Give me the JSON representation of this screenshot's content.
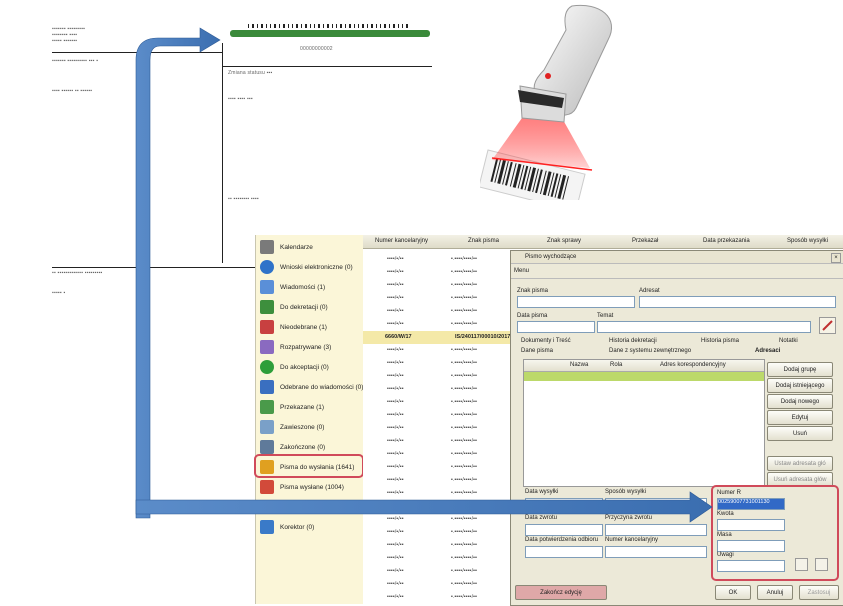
{
  "document": {
    "barcode_number": "00000000002",
    "redacted_lines": [
      "Zmiana statusu ▪▪▪",
      "▪▪▪▪ ▪▪▪▪ ▪▪▪",
      "▪▪ ▪▪▪▪▪▪▪▪ ▪▪▪▪"
    ]
  },
  "app": {
    "nav": [
      {
        "label": "Kalendarze",
        "color": "#6b6b6b"
      },
      {
        "label": "Wnioski elektroniczne (0)",
        "color": "#2f73c9"
      },
      {
        "label": "Wiadomości (1)",
        "color": "#5a8fd8"
      },
      {
        "label": "Do dekretacji (0)",
        "color": "#3d8f3d"
      },
      {
        "label": "Nieodebrane (1)",
        "color": "#c84040"
      },
      {
        "label": "Rozpatrywane (3)",
        "color": "#8a6ac0"
      },
      {
        "label": "Do akceptacji (0)",
        "color": "#2e9e3a"
      },
      {
        "label": "Odebrane do wiadomości (0)",
        "color": "#3a6fc0"
      },
      {
        "label": "Przekazane (1)",
        "color": "#4a9a4a"
      },
      {
        "label": "Zawieszone (0)",
        "color": "#7aa0c8"
      },
      {
        "label": "Zakończone (0)",
        "color": "#5f7a9a"
      },
      {
        "label": "Pisma do wysłania (1641)",
        "color": "#e0a020"
      },
      {
        "label": "Pisma wysłane (1004)",
        "color": "#d24a3a"
      },
      {
        "label": "Korektor (0)",
        "color": "#3a7ac8"
      }
    ],
    "grid_headers": [
      "Numer kancelaryjny",
      "Znak pisma",
      "Znak sprawy",
      "Przekazał",
      "Data przekazania",
      "Sposób wysyłki"
    ],
    "grid_selected": {
      "numer": "6660/W/17",
      "znak": "IS/240117/00010/2017"
    },
    "dialog": {
      "title": "Pismo wychodzące",
      "menu": "Menu",
      "znak_pisma_label": "Znak pisma",
      "adresat_label": "Adresat",
      "data_pisma_label": "Data pisma",
      "temat_label": "Temat",
      "tabs_row1": [
        "Dokumenty i Treść",
        "Historia dekretacji",
        "Historia pisma",
        "Notatki"
      ],
      "tabs_row2": [
        "Dane pisma",
        "Dane z systemu zewnętrznego",
        "Adresaci"
      ],
      "table_headers": [
        "Nazwa",
        "Rola",
        "Adres korespondencyjny"
      ],
      "side_buttons": [
        "Dodaj grupę",
        "Dodaj istniejącego",
        "Dodaj nowego",
        "Edytuj",
        "Usuń",
        "Ustaw adresata głó",
        "Usuń adresata głów"
      ],
      "labels": {
        "data_wysylki": "Data wysyłki",
        "sposob_wysylki": "Sposób wysyłki",
        "data_zwrotu": "Data zwrotu",
        "przyczyna_zwrotu": "Przyczyna zwrotu",
        "data_potwierdzenia": "Data potwierdzenia odbioru",
        "numer_kancelaryjny": "Numer kancelaryjny"
      },
      "numer_r_label": "Numer R",
      "numer_r_value": "00259007731001130",
      "kwota_label": "Kwota",
      "masa_label": "Masa",
      "uwagi_label": "Uwagi",
      "footer": {
        "finish": "Zakończ edycję",
        "ok": "OK",
        "cancel": "Anuluj",
        "apply": "Zastosuj"
      }
    }
  }
}
